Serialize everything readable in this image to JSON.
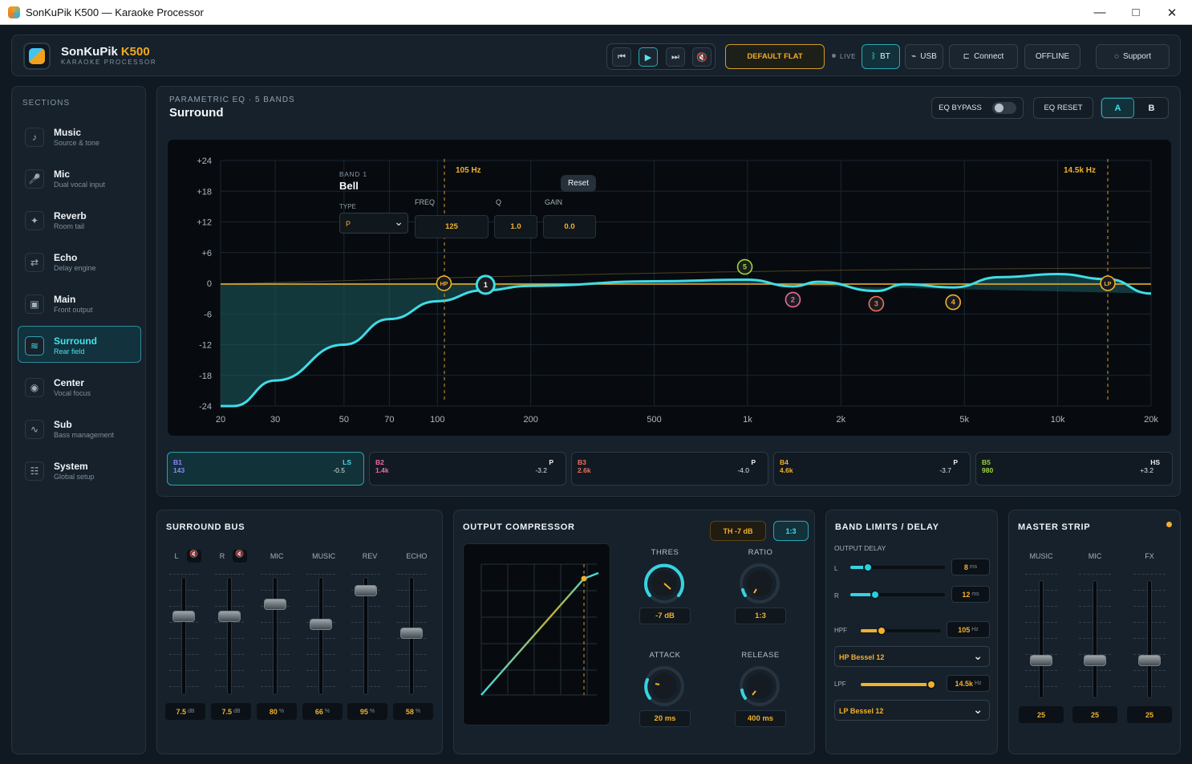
{
  "window": {
    "title": "SonKuPik K500 — Karaoke Processor",
    "min": "—",
    "max": "□",
    "close": "✕"
  },
  "brand": {
    "name": "SonKuPik",
    "model": "K500",
    "subtitle": "KARAOKE PROCESSOR"
  },
  "transport": {
    "prev_icon": "skip-back-icon",
    "play_icon": "play-icon",
    "next_icon": "skip-forward-icon",
    "mute_icon": "mute-icon"
  },
  "top": {
    "preset": "DEFAULT FLAT",
    "live": "LIVE",
    "bt": "BT",
    "usb": "USB",
    "connect": "Connect",
    "offline": "OFFLINE",
    "support": "Support"
  },
  "sidebar": {
    "heading": "SECTIONS",
    "items": [
      {
        "title": "Music",
        "sub": "Source & tone",
        "icon": "♪"
      },
      {
        "title": "Mic",
        "sub": "Dual vocal input",
        "icon": "🎤"
      },
      {
        "title": "Reverb",
        "sub": "Room tail",
        "icon": "✦"
      },
      {
        "title": "Echo",
        "sub": "Delay engine",
        "icon": "⇄"
      },
      {
        "title": "Main",
        "sub": "Front output",
        "icon": "▣"
      },
      {
        "title": "Surround",
        "sub": "Rear field",
        "icon": "≋"
      },
      {
        "title": "Center",
        "sub": "Vocal focus",
        "icon": "◉"
      },
      {
        "title": "Sub",
        "sub": "Bass management",
        "icon": "∿"
      },
      {
        "title": "System",
        "sub": "Global setup",
        "icon": "☷"
      }
    ]
  },
  "eq": {
    "kicker": "PARAMETRIC EQ",
    "bands_label": "5 BANDS",
    "section": "Surround",
    "bypass": "EQ BYPASS",
    "reset": "EQ RESET",
    "a": "A",
    "b": "B",
    "inline_reset": "Reset",
    "band_label": "BAND 1",
    "band_type": "Bell",
    "type_label": "TYPE",
    "type_value": "P",
    "freq_label": "FREQ",
    "freq": "125",
    "q_label": "Q",
    "q": "1.0",
    "gain_label": "GAIN",
    "gain": "0.0",
    "hp_marker": "105 Hz",
    "lp_marker": "14.5k Hz",
    "hp_node": "HP",
    "lp_node": "LP",
    "colors": {
      "band1": "#8f84ff",
      "band2": "#ec6ba1",
      "band3": "#f0715e",
      "band4": "#f1b12d",
      "band5": "#9dd53a",
      "curve": "#41dce6"
    },
    "chips": [
      {
        "name": "B1",
        "hz": "143",
        "type": "LS",
        "gain": "-0.5",
        "color": "#8f84ff"
      },
      {
        "name": "B2",
        "hz": "1.4k",
        "type": "P",
        "gain": "-3.2",
        "color": "#ec6ba1"
      },
      {
        "name": "B3",
        "hz": "2.6k",
        "type": "P",
        "gain": "-4.0",
        "color": "#f0715e"
      },
      {
        "name": "B4",
        "hz": "4.6k",
        "type": "P",
        "gain": "-3.7",
        "color": "#f1b12d"
      },
      {
        "name": "B5",
        "hz": "980",
        "type": "HS",
        "gain": "+3.2",
        "color": "#9dd53a"
      }
    ]
  },
  "chart_data": {
    "type": "line",
    "xlabel": "",
    "ylabel": "",
    "x_scale": "log",
    "xlim": [
      20,
      20000
    ],
    "ylim": [
      -24,
      24
    ],
    "x_ticks": [
      "20",
      "30",
      "50",
      "70",
      "100",
      "200",
      "500",
      "1k",
      "2k",
      "5k",
      "10k",
      "20k"
    ],
    "y_ticks": [
      "+24",
      "+18",
      "+12",
      "+6",
      "0",
      "-6",
      "-12",
      "-18",
      "-24"
    ],
    "series": [
      {
        "points": [
          [
            20,
            -24
          ],
          [
            22,
            -24
          ],
          [
            30,
            -19
          ],
          [
            50,
            -12
          ],
          [
            70,
            -7
          ],
          [
            100,
            -3.5
          ],
          [
            140,
            -1.4
          ],
          [
            200,
            -0.5
          ],
          [
            500,
            0.4
          ],
          [
            1000,
            0.7
          ],
          [
            1400,
            -0.6
          ],
          [
            1700,
            0.3
          ],
          [
            2600,
            -1.5
          ],
          [
            3200,
            -0.2
          ],
          [
            4600,
            -0.8
          ],
          [
            6500,
            1.2
          ],
          [
            10000,
            1.8
          ],
          [
            14500,
            0.8
          ],
          [
            20000,
            -2
          ]
        ]
      }
    ],
    "nodes": [
      {
        "label": "HP",
        "x": 105,
        "y": 0
      },
      {
        "label": "1",
        "x": 143,
        "y": -0.3
      },
      {
        "label": "5",
        "x": 980,
        "y": 3.2
      },
      {
        "label": "2",
        "x": 1400,
        "y": -3.2
      },
      {
        "label": "3",
        "x": 2600,
        "y": -4.0
      },
      {
        "label": "4",
        "x": 4600,
        "y": -3.7
      },
      {
        "label": "LP",
        "x": 14500,
        "y": 0
      }
    ]
  },
  "surround": {
    "title": "SURROUND BUS",
    "faders": [
      {
        "label": "L",
        "value": "7.5",
        "unit": "dB",
        "level": 0.7
      },
      {
        "label": "R",
        "value": "7.5",
        "unit": "dB",
        "level": 0.7
      },
      {
        "label": "MIC",
        "value": "80",
        "unit": "%",
        "level": 0.8
      },
      {
        "label": "MUSIC",
        "value": "66",
        "unit": "%",
        "level": 0.63
      },
      {
        "label": "REV",
        "value": "95",
        "unit": "%",
        "level": 0.92
      },
      {
        "label": "ECHO",
        "value": "58",
        "unit": "%",
        "level": 0.56
      }
    ]
  },
  "compressor": {
    "title": "OUTPUT COMPRESSOR",
    "th_badge": "TH -7 dB",
    "ratio_badge": "1:3",
    "thres_label": "THRES",
    "thres": "-7 dB",
    "ratio_label": "RATIO",
    "ratio": "1:3",
    "attack_label": "ATTACK",
    "attack": "20 ms",
    "release_label": "RELEASE",
    "release": "400 ms"
  },
  "limits": {
    "title": "BAND LIMITS / DELAY",
    "output_delay": "OUTPUT DELAY",
    "l_label": "L",
    "l_value": "8",
    "r_label": "R",
    "r_value": "12",
    "ms": "ms",
    "hpf_label": "HPF",
    "hpf": "105",
    "hpf_unit": "Hz",
    "hp_filter": "HP Bessel 12",
    "lpf_label": "LPF",
    "lpf": "14.5k",
    "lpf_unit": "Hz",
    "lp_filter": "LP Bessel 12"
  },
  "master": {
    "title": "MASTER STRIP",
    "faders": [
      {
        "label": "MUSIC",
        "value": "25"
      },
      {
        "label": "MIC",
        "value": "25"
      },
      {
        "label": "FX",
        "value": "25"
      }
    ]
  }
}
